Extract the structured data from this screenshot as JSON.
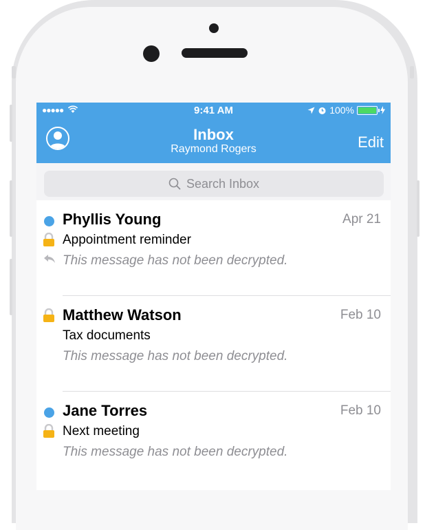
{
  "status_bar": {
    "signal": "●●●●●",
    "time": "9:41 AM",
    "battery": "100%"
  },
  "header": {
    "title": "Inbox",
    "subtitle": "Raymond Rogers",
    "edit_label": "Edit"
  },
  "search": {
    "placeholder": "Search Inbox"
  },
  "colors": {
    "accent": "#4aa3e6",
    "unread_dot": "#4aa3e6",
    "lock": "#f5b316"
  },
  "messages": [
    {
      "sender": "Phyllis Young",
      "date": "Apr 21",
      "subject": "Appointment reminder",
      "preview": "This message has not been decrypted.",
      "unread": true,
      "locked": true,
      "replied": true
    },
    {
      "sender": "Matthew Watson",
      "date": "Feb 10",
      "subject": "Tax documents",
      "preview": "This message has not been decrypted.",
      "unread": false,
      "locked": true,
      "replied": false
    },
    {
      "sender": "Jane Torres",
      "date": "Feb 10",
      "subject": "Next meeting",
      "preview": "This message has not been decrypted.",
      "unread": true,
      "locked": true,
      "replied": false
    }
  ]
}
